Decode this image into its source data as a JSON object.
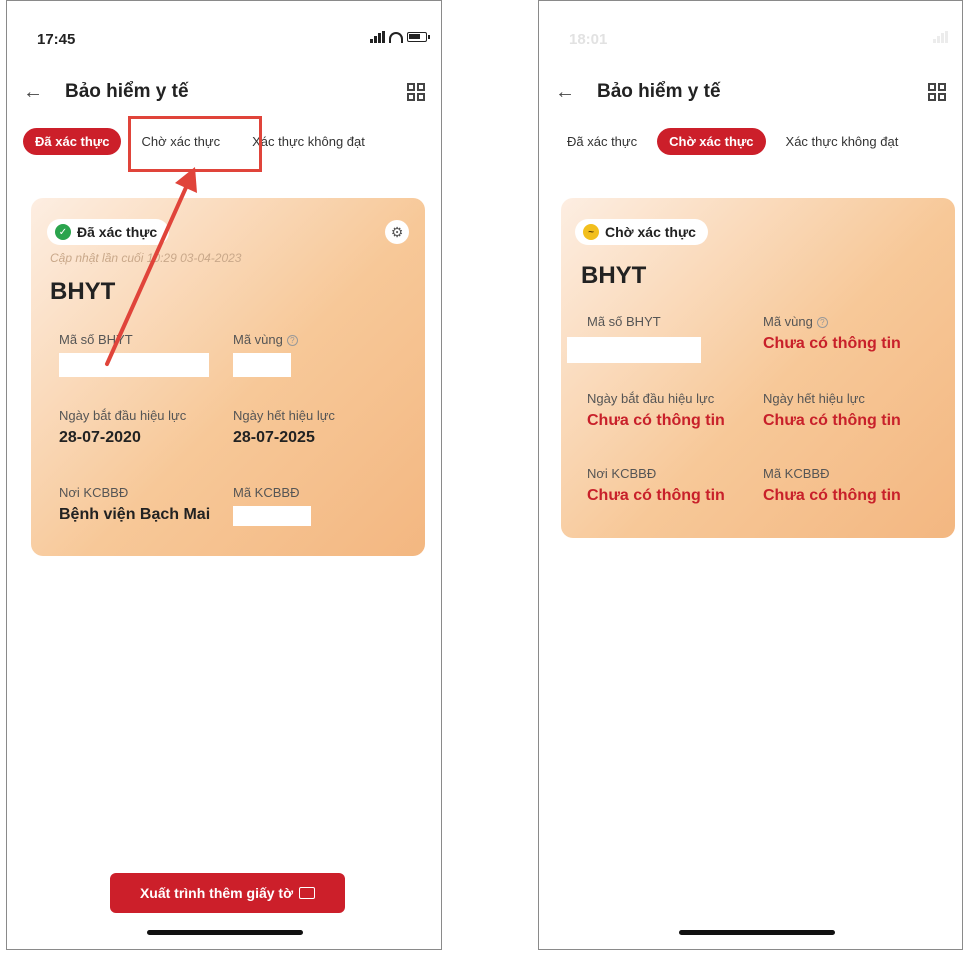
{
  "status_bar": {
    "time_left": "17:45",
    "time_right": "18:01"
  },
  "header": {
    "title": "Bảo hiểm y tế"
  },
  "tabs": [
    "Đã xác thực",
    "Chờ xác thực",
    "Xác thực không đạt"
  ],
  "left": {
    "badge": "Đã xác thực",
    "updated": "Cập nhật lần cuối 10:29 03-04-2023",
    "card_title": "BHYT",
    "fields": [
      {
        "label": "Mã số BHYT",
        "value": ""
      },
      {
        "label": "Mã vùng",
        "value": ""
      },
      {
        "label": "Ngày bắt đầu hiệu lực",
        "value": "28-07-2020"
      },
      {
        "label": "Ngày hết hiệu lực",
        "value": "28-07-2025"
      },
      {
        "label": "Nơi KCBBĐ",
        "value": "Bệnh viện Bạch Mai"
      },
      {
        "label": "Mã KCBBĐ",
        "value": ""
      }
    ],
    "cta": "Xuất trình thêm giấy tờ"
  },
  "right": {
    "badge": "Chờ xác thực",
    "card_title": "BHYT",
    "fields": [
      {
        "label": "Mã số BHYT",
        "value": ""
      },
      {
        "label": "Mã vùng",
        "value": "Chưa có thông tin"
      },
      {
        "label": "Ngày bắt đầu hiệu lực",
        "value": "Chưa có thông tin"
      },
      {
        "label": "Ngày hết hiệu lực",
        "value": "Chưa có thông tin"
      },
      {
        "label": "Nơi KCBBĐ",
        "value": "Chưa có thông tin"
      },
      {
        "label": "Mã KCBBĐ",
        "value": "Chưa có thông tin"
      }
    ]
  },
  "colors": {
    "accent": "#cc1f2a",
    "highlight": "#e0443a",
    "verified": "#2aa44d",
    "pending": "#f2bf1d"
  },
  "icons": [
    "back-arrow-icon",
    "qr-code-icon",
    "check-icon",
    "pending-icon",
    "gear-icon",
    "help-icon",
    "id-card-icon"
  ]
}
